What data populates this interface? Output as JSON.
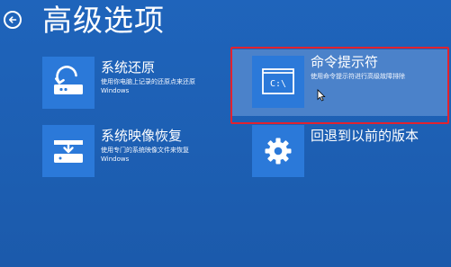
{
  "header": {
    "title": "高级选项"
  },
  "options": [
    {
      "label": "系统还原",
      "description_line1": "使用你电脑上记录的还原点来还原",
      "description_line2": "Windows",
      "icon": "system-restore-icon"
    },
    {
      "label": "命令提示符",
      "description_line1": "使用命令提示符进行高级故障排除",
      "description_line2": "",
      "icon": "command-prompt-icon",
      "icon_text": "C:\\"
    },
    {
      "label": "系统映像恢复",
      "description_line1": "使用专门的系统映像文件来恢复",
      "description_line2": "Windows",
      "icon": "system-image-icon"
    },
    {
      "label": "回退到以前的版本",
      "description_line1": "",
      "description_line2": "",
      "icon": "gear-icon"
    }
  ],
  "colors": {
    "background": "#1f62b7",
    "tile": "#2b79d9",
    "highlight": "#4b82ca",
    "annotation": "#e2222f",
    "text": "#ffffff"
  }
}
